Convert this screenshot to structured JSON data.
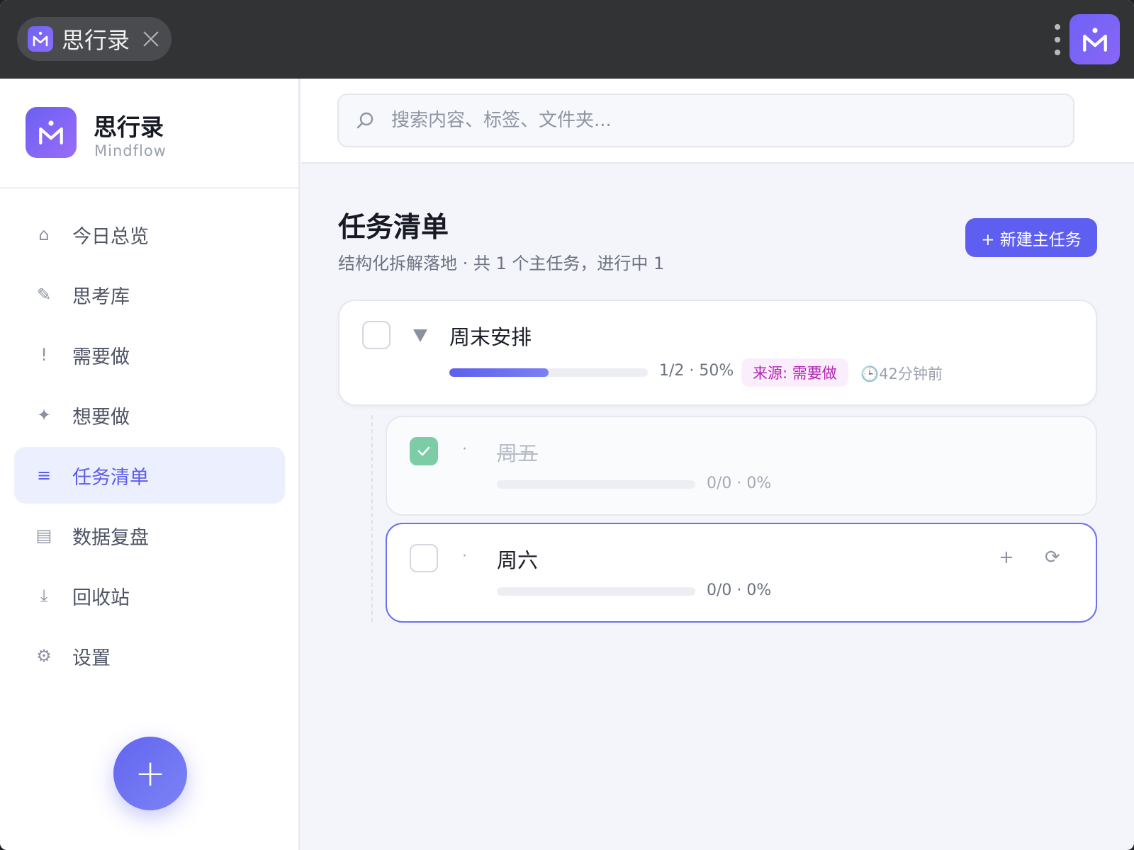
{
  "window": {
    "tab_title": "思行录"
  },
  "brand": {
    "name": "思行录",
    "subtitle": "Mindflow"
  },
  "nav": [
    {
      "icon": "home-icon",
      "glyph": "⌂",
      "label": "今日总览",
      "active": false
    },
    {
      "icon": "pencil-icon",
      "glyph": "✎",
      "label": "思考库",
      "active": false
    },
    {
      "icon": "exclamation-icon",
      "glyph": "!",
      "label": "需要做",
      "active": false
    },
    {
      "icon": "sparkle-icon",
      "glyph": "✦",
      "label": "想要做",
      "active": false
    },
    {
      "icon": "list-icon",
      "glyph": "≡",
      "label": "任务清单",
      "active": true
    },
    {
      "icon": "chart-icon",
      "glyph": "▤",
      "label": "数据复盘",
      "active": false
    },
    {
      "icon": "trash-icon",
      "glyph": "⤓",
      "label": "回收站",
      "active": false
    },
    {
      "icon": "gear-icon",
      "glyph": "⚙",
      "label": "设置",
      "active": false
    }
  ],
  "fab_label": "+",
  "search": {
    "placeholder": "搜索内容、标签、文件夹..."
  },
  "page": {
    "title": "任务清单",
    "subtitle": "结构化拆解落地 · 共 1 个主任务，进行中 1",
    "new_button": "+ 新建主任务"
  },
  "tasks": [
    {
      "title": "周末安排",
      "done": false,
      "progress": 0.5,
      "progress_text": "1/2 · 50%",
      "source": "来源: 需要做",
      "time": "🕒42分钟前",
      "children": [
        {
          "title": "周五",
          "done": true,
          "progress": 0,
          "progress_text": "0/0 · 0%"
        },
        {
          "title": "周六",
          "done": false,
          "progress": 0,
          "progress_text": "0/0 · 0%",
          "selected": true,
          "actions": [
            "+",
            "⟳"
          ]
        }
      ]
    }
  ],
  "colors": {
    "accent": "#5e5ff0",
    "done_check": "#7ccda6",
    "source_badge_text": "#b125b6",
    "source_badge_bg": "#fbeefc"
  }
}
